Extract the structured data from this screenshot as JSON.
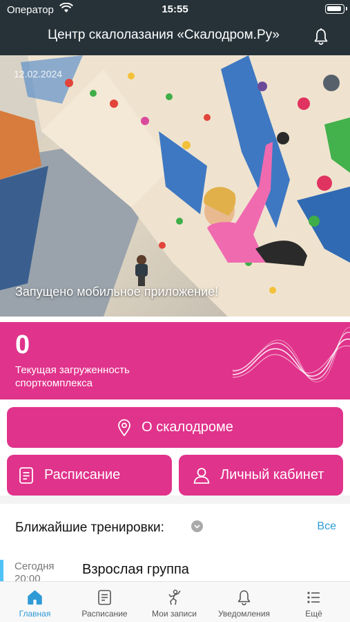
{
  "status_bar": {
    "carrier": "Оператор",
    "time": "15:55"
  },
  "header": {
    "title": "Центр скалолазания «Скалодром.Ру»"
  },
  "news": {
    "date": "12.02.2024",
    "caption": "Запущено мобильное приложение!"
  },
  "load": {
    "value": "0",
    "label": "Текущая загруженность спорткомплекса"
  },
  "buttons": {
    "about": "О скалодроме",
    "schedule": "Расписание",
    "cabinet": "Личный кабинет"
  },
  "trainings": {
    "title": "Ближайшие тренировки:",
    "all_link": "Все",
    "items": [
      {
        "day": "Сегодня",
        "time": "20:00",
        "name": "Взрослая группа"
      }
    ]
  },
  "tabbar": {
    "items": [
      {
        "label": "Главная",
        "icon": "home-icon",
        "active": true
      },
      {
        "label": "Расписание",
        "icon": "schedule-icon",
        "active": false
      },
      {
        "label": "Мои записи",
        "icon": "climber-icon",
        "active": false
      },
      {
        "label": "Уведомления",
        "icon": "bell-icon",
        "active": false
      },
      {
        "label": "Ещё",
        "icon": "list-icon",
        "active": false
      }
    ]
  },
  "colors": {
    "header_bg": "#263238",
    "accent_pink": "#e0338b",
    "link_blue": "#2f9ad6"
  }
}
